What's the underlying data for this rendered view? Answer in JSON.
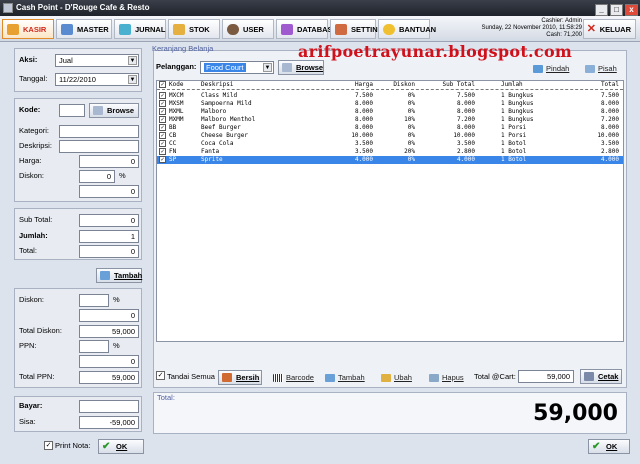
{
  "window": {
    "title": "Cash Point - D'Rouge Cafe & Resto",
    "ctrl_min": "_",
    "ctrl_max": "□",
    "ctrl_close": "x"
  },
  "menu": {
    "items": [
      {
        "label": "KASIR",
        "icon": "cashier-icon"
      },
      {
        "label": "MASTER",
        "icon": "master-icon"
      },
      {
        "label": "JURNAL",
        "icon": "journal-icon"
      },
      {
        "label": "STOK",
        "icon": "stock-icon"
      },
      {
        "label": "USER",
        "icon": "user-icon"
      },
      {
        "label": "DATABASE",
        "icon": "database-icon"
      },
      {
        "label": "SETTING",
        "icon": "settings-icon"
      },
      {
        "label": "BANTUAN",
        "icon": "help-icon"
      }
    ],
    "keluar": "KELUAR"
  },
  "userinfo": {
    "line1": "Cashier: Admin",
    "line2": "Sunday, 22 November 2010, 11:58:29",
    "line3": "Cash: 71,200"
  },
  "watermark": "arifpoetrayunar.blogspot.com",
  "left": {
    "aksi_label": "Aksi:",
    "aksi_value": "Jual",
    "tanggal_label": "Tanggal:",
    "tanggal_value": "11/22/2010",
    "kode_label": "Kode:",
    "kode_value": "",
    "browse": "Browse",
    "kategori_label": "Kategori:",
    "deskripsi_label": "Deskripsi:",
    "harga_label": "Harga:",
    "harga_value": "0",
    "diskon_label": "Diskon:",
    "diskon_pct": "0",
    "pct_sign": "%",
    "diskon_value": "0",
    "subtotal_label": "Sub Total:",
    "subtotal_value": "0",
    "jumlah_label": "Jumlah:",
    "jumlah_value": "1",
    "total_label": "Total:",
    "total_value": "0",
    "tambah": "Tambah",
    "diskon2_label": "Diskon:",
    "diskon2_pct": "",
    "diskon2_value": "0",
    "total_diskon_label": "Total Diskon:",
    "total_diskon_value": "59,000",
    "ppn_label": "PPN:",
    "ppn_pct": "",
    "ppn_value": "0",
    "total_ppn_label": "Total PPN:",
    "total_ppn_value": "59,000",
    "bayar_label": "Bayar:",
    "bayar_value": "",
    "sisa_label": "Sisa:",
    "sisa_value": "-59,000",
    "print_nota": "Print Nota:",
    "ok": "OK"
  },
  "cart": {
    "group_caption": "Keranjang Belanja",
    "pelanggan_label": "Pelanggan:",
    "pelanggan_value": "Food Court",
    "browse": "Browse",
    "pindah": "Pindah",
    "pisah": "Pisah",
    "columns": [
      "Kode",
      "Deskripsi",
      "Harga",
      "Diskon",
      "Sub Total",
      "Jumlah",
      "Total"
    ],
    "rows": [
      [
        "MXCM",
        "Class Mild",
        "7.500",
        "0%",
        "7.500",
        "1 Bungkus",
        "7.500"
      ],
      [
        "MXSM",
        "Sampoerna Mild",
        "8.000",
        "0%",
        "8.000",
        "1 Bungkus",
        "8.000"
      ],
      [
        "MXML",
        "Malboro",
        "8.000",
        "0%",
        "8.000",
        "1 Bungkus",
        "8.000"
      ],
      [
        "MXMM",
        "Malboro Menthol",
        "8.000",
        "10%",
        "7.200",
        "1 Bungkus",
        "7.200"
      ],
      [
        "BB",
        "Beef Burger",
        "8.000",
        "0%",
        "8.000",
        "1 Porsi",
        "8.000"
      ],
      [
        "CB",
        "Cheese Burger",
        "10.000",
        "0%",
        "10.000",
        "1 Porsi",
        "10.000"
      ],
      [
        "CC",
        "Coca Cola",
        "3.500",
        "0%",
        "3.500",
        "1 Botol",
        "3.500"
      ],
      [
        "FN",
        "Fanta",
        "3.500",
        "20%",
        "2.800",
        "1 Botol",
        "2.800"
      ],
      [
        "SP",
        "Sprite",
        "4.000",
        "0%",
        "4.000",
        "1 Botol",
        "4.000"
      ]
    ],
    "tandai_semua": "Tandai Semua",
    "bersih": "Bersih",
    "barcode": "Barcode",
    "tambah": "Tambah",
    "ubah": "Ubah",
    "hapus": "Hapus",
    "total_cart_label": "Total @Cart:",
    "total_cart_value": "59,000",
    "cetak": "Cetak"
  },
  "total": {
    "caption": "Total:",
    "value": "59,000",
    "ok": "OK"
  },
  "colors": {
    "accent_red": "#d0281c",
    "selection": "#3a86e8",
    "watermark": "#d0101a"
  }
}
